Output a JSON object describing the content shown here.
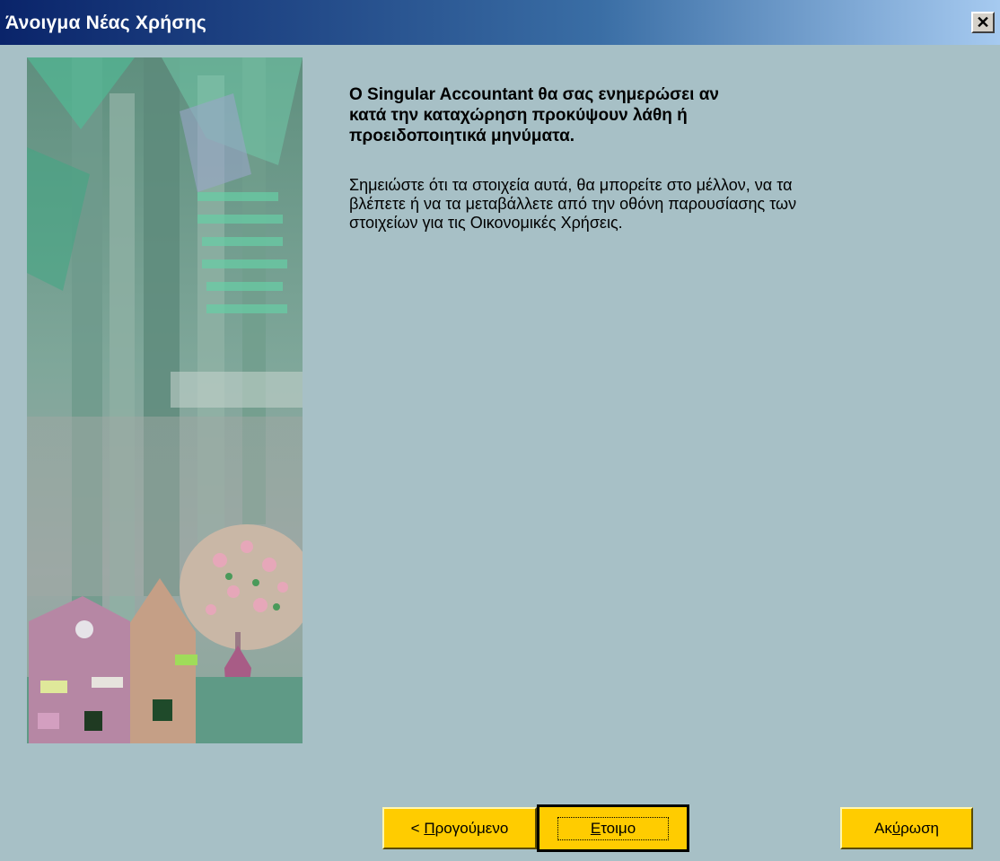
{
  "window": {
    "title": "Άνοιγμα Νέας Χρήσης",
    "close_icon": "close-icon"
  },
  "content": {
    "heading_lines": [
      "Ο Singular Accountant θα σας ενημερώσει αν",
      "κατά την καταχώρηση προκύψουν λάθη ή",
      "προειδοποιητικά μηνύματα."
    ],
    "body_lines": [
      "Σημειώστε ότι τα στοιχεία αυτά, θα μπορείτε στο μέλλον, να τα",
      "βλέπετε ή να τα μεταβάλλετε από την οθόνη παρουσίασης των",
      "στοιχείων για τις Οικονομικές Χρήσεις."
    ]
  },
  "buttons": {
    "back": {
      "prefix": "< ",
      "mnemonic": "Π",
      "rest": "ρογούμενο"
    },
    "finish": {
      "mnemonic": "Ε",
      "rest": "τοιμο"
    },
    "cancel": {
      "before": "Ακ",
      "mnemonic": "ύ",
      "rest": "ρωση"
    }
  },
  "colors": {
    "dialog_bg": "#a7c0c6",
    "button": "#ffcc00",
    "titlebar_start": "#0a246a",
    "titlebar_end": "#a6caf0"
  }
}
